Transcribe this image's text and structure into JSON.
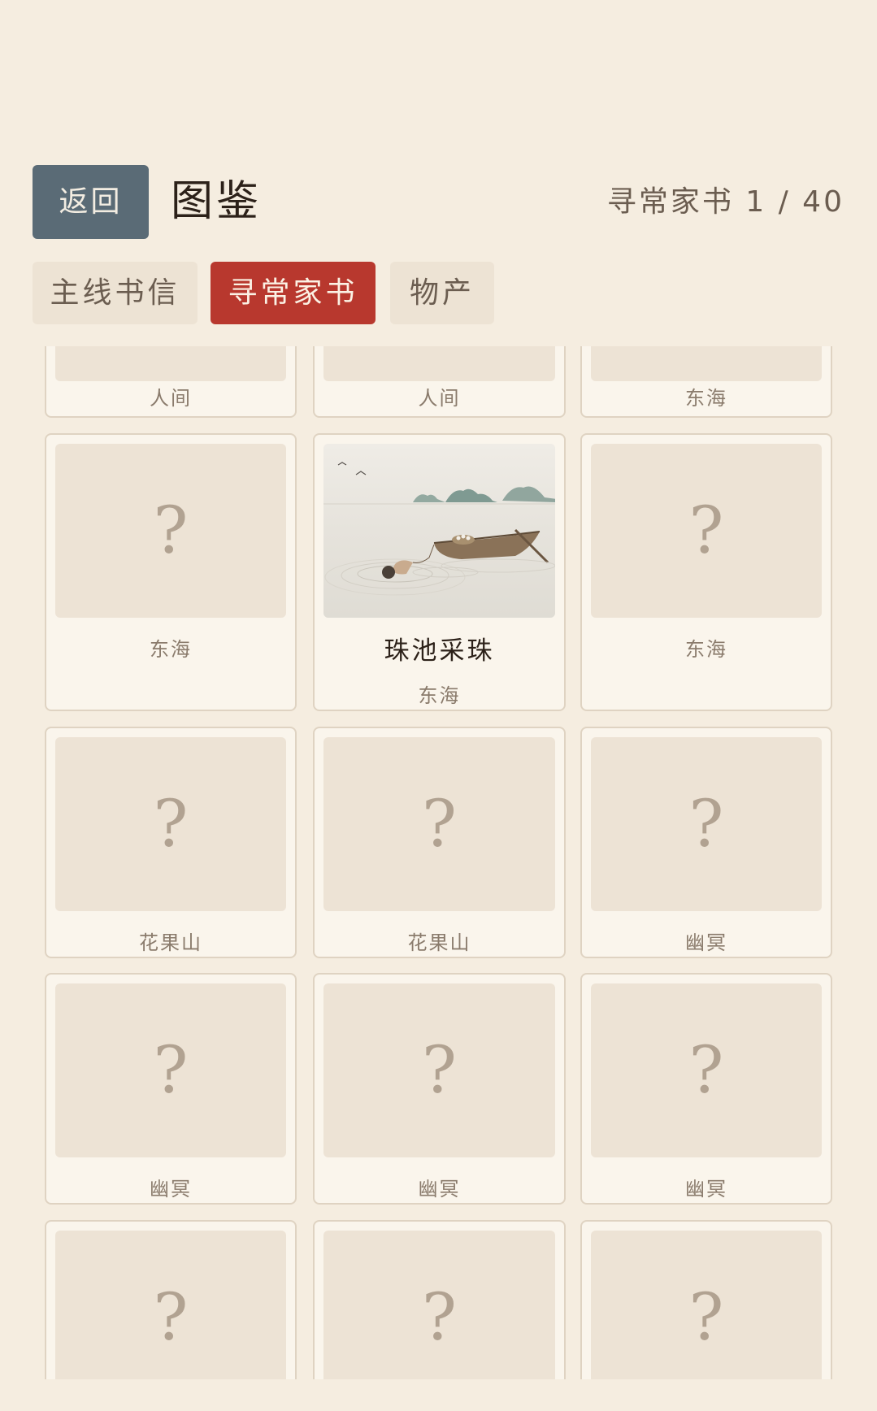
{
  "header": {
    "back_label": "返回",
    "title": "图鉴",
    "progress": "寻常家书 1 / 40"
  },
  "tabs": [
    {
      "label": "主线书信",
      "active": false
    },
    {
      "label": "寻常家书",
      "active": true
    },
    {
      "label": "物产",
      "active": false
    }
  ],
  "grid": {
    "row0": [
      {
        "region": "人间",
        "unlocked": false
      },
      {
        "region": "人间",
        "unlocked": false
      },
      {
        "region": "东海",
        "unlocked": false
      }
    ],
    "row1": [
      {
        "region": "东海",
        "unlocked": false
      },
      {
        "title": "珠池采珠",
        "region": "东海",
        "unlocked": true
      },
      {
        "region": "东海",
        "unlocked": false
      }
    ],
    "row2": [
      {
        "region": "花果山",
        "unlocked": false
      },
      {
        "region": "花果山",
        "unlocked": false
      },
      {
        "region": "幽冥",
        "unlocked": false
      }
    ],
    "row3": [
      {
        "region": "幽冥",
        "unlocked": false
      },
      {
        "region": "幽冥",
        "unlocked": false
      },
      {
        "region": "幽冥",
        "unlocked": false
      }
    ],
    "row4": [
      {
        "unlocked": false
      },
      {
        "unlocked": false
      },
      {
        "unlocked": false
      }
    ],
    "locked_symbol": "?"
  },
  "colors": {
    "background": "#f5ede0",
    "accent_red": "#b8382e",
    "back_button": "#5a6b76",
    "card_bg": "#faf5ec"
  }
}
